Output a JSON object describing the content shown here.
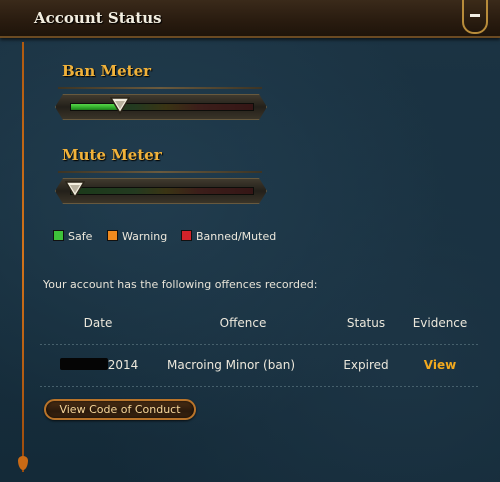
{
  "header": {
    "title": "Account Status"
  },
  "ban_meter": {
    "title": "Ban Meter",
    "fill_fraction": 0.27
  },
  "mute_meter": {
    "title": "Mute Meter",
    "fill_fraction": 0.0
  },
  "legend": [
    {
      "label": "Safe",
      "color": "#3ec23a"
    },
    {
      "label": "Warning",
      "color": "#f08a1e"
    },
    {
      "label": "Banned/Muted",
      "color": "#d2232a"
    }
  ],
  "offences": {
    "intro": "Your account has the following offences recorded:",
    "columns": [
      "Date",
      "Offence",
      "Status",
      "Evidence"
    ],
    "rows": [
      {
        "date": "2014",
        "offence": "Macroing Minor (ban)",
        "status": "Expired",
        "evidence": "View"
      }
    ]
  },
  "code_of_conduct_button": "View Code of Conduct",
  "colors": {
    "accent_gold": "#f1b23a",
    "link_orange": "#f2a91e"
  }
}
